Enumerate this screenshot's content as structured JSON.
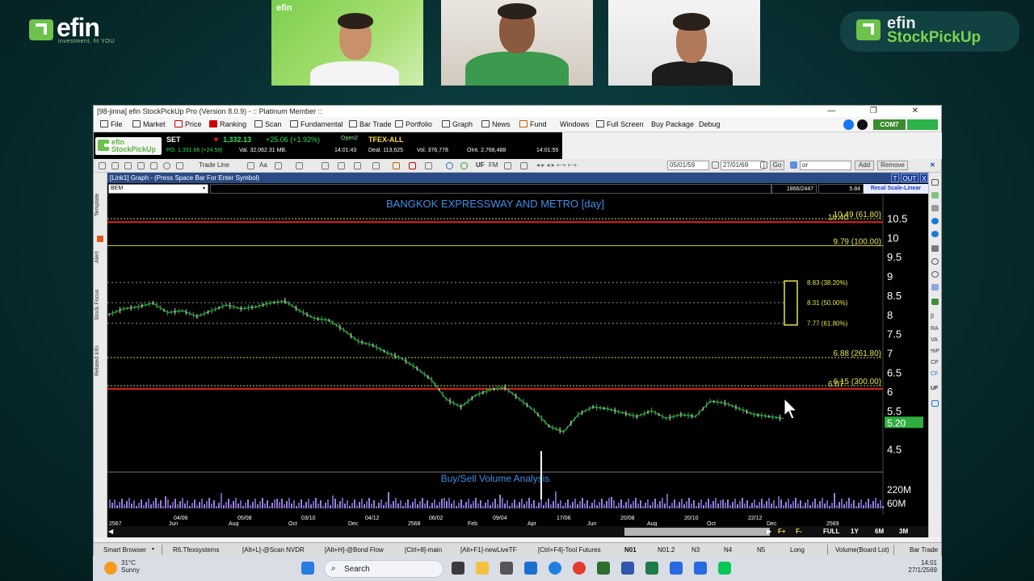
{
  "branding": {
    "left_word": "efin",
    "left_tagline": "investment, fit YOU",
    "right_word1": "efin",
    "right_word2": "StockPickUp",
    "tile_logo": "efin"
  },
  "window": {
    "title": "[98-jinna] efin StockPickUp Pro (Version 8.0.9) - :: Platinum Member ::",
    "controls": "—   ❐   ✕"
  },
  "menu": {
    "items": [
      "File",
      "Market",
      "Price",
      "Ranking",
      "Scan",
      "Fundamental",
      "Bar Trade",
      "Portfolio",
      "Graph",
      "News",
      "Fund",
      "Windows",
      "Full Screen",
      "Buy Package",
      "Debug"
    ],
    "com7": "COM7"
  },
  "ticker": {
    "logo1": "efin",
    "logo2": "StockPickUp",
    "set_label": "SET",
    "set_value": "1,332.13",
    "set_change": "+25.06 (+1.92%)",
    "set_status": "Open2",
    "po_line": "PO. 1,331.66 (+24.59)",
    "val_line": "Val. 32,062.31 MB.",
    "time1": "14:01:43",
    "tfex_label": "TFEX-ALL",
    "deal": "Deal. 113,625",
    "vol": "Vol. 376,778",
    "oint": "OInt. 2,768,488",
    "time2": "14:01:55"
  },
  "toolbar": {
    "trade_line": "Trade Line",
    "aa": "Aa",
    "uf": "UF",
    "fm": "FM",
    "date_from": "05/01/59",
    "date_to": "27/01/69",
    "go": "Go",
    "filter_value": "or",
    "add": "Add",
    "remove": "Remove"
  },
  "graph_header": {
    "title": "[Link1] Graph - (Press Space Bar For Enter Symbol)",
    "btn_t": "T",
    "btn_out": "OUT",
    "btn_x": "X"
  },
  "symbol_bar": {
    "symbol": "BEM",
    "bars_info": "1866/2447",
    "price_info": "5.84",
    "recal": "Recal Scale-Linear"
  },
  "left_tabs": [
    "Template",
    "Alert",
    "Stock Focus",
    "Related Info"
  ],
  "right_tools": [
    "β",
    "RA",
    "VA",
    "%P",
    "CP",
    "CF",
    "UF"
  ],
  "chart_data": {
    "type": "line",
    "title": "BANGKOK EXPRESSWAY AND METRO [day]",
    "subpanel_title": "Buy/Sell Volume Analysis",
    "y_ticks": [
      "10.5",
      "10",
      "9.5",
      "9",
      "8.5",
      "8",
      "7.5",
      "7",
      "6.5",
      "6",
      "5.5",
      "5.20",
      "4.5"
    ],
    "ylim": [
      4.2,
      10.7
    ],
    "volume_ticks": [
      "220M",
      "60M"
    ],
    "current_price": "5.20",
    "fib_levels": [
      {
        "label": "10.49 (61.80)",
        "value": 10.49
      },
      {
        "label": "9.79 (100.00)",
        "value": 9.79
      },
      {
        "label": "6.88 (261.80)",
        "value": 6.88
      },
      {
        "label": "6.15 (300.00)",
        "value": 6.15
      }
    ],
    "red_lines": [
      {
        "label": "10.40",
        "value": 10.4
      },
      {
        "label": "6.07",
        "value": 6.07
      }
    ],
    "box_levels": [
      {
        "label": "8.83 (38.20%)",
        "value": 8.83
      },
      {
        "label": "8.31 (50.00%)",
        "value": 8.31
      },
      {
        "label": "7.77 (61.80%)",
        "value": 7.77
      }
    ],
    "x_ticks_top": [
      "04/06",
      "05/08",
      "03/10",
      "04/12",
      "06/02",
      "09/04",
      "17/06",
      "20/08",
      "20/10",
      "22/12"
    ],
    "x_ticks_bottom": [
      "2567",
      "Jun",
      "Aug",
      "Oct",
      "Dec",
      "2568",
      "Feb",
      "Apr",
      "Jun",
      "Aug",
      "Oct",
      "Dec",
      "2569"
    ],
    "price_series": [
      8.0,
      8.15,
      8.2,
      8.3,
      8.05,
      8.1,
      7.95,
      8.1,
      8.25,
      8.15,
      8.2,
      8.3,
      8.35,
      8.1,
      7.9,
      7.85,
      7.6,
      7.3,
      7.2,
      7.0,
      6.85,
      6.6,
      6.3,
      5.8,
      5.6,
      5.9,
      6.05,
      6.1,
      5.8,
      5.5,
      5.1,
      4.95,
      5.4,
      5.6,
      5.55,
      5.45,
      5.35,
      5.5,
      5.3,
      5.4,
      5.35,
      5.75,
      5.7,
      5.55,
      5.4,
      5.35,
      5.3
    ]
  },
  "periods": [
    "F+",
    "F-",
    "FULL",
    "1Y",
    "6M",
    "3M"
  ],
  "status_tabs": [
    "Smart Browser",
    "R6.Tfexsystems",
    "[Alt+L]-@Scan NVDR",
    "[Alt+H]-@Bond Flow",
    "[Ctrl+8]-main",
    "[Alt+F1]-newLiveTF",
    "[Ctrl+F4]-Tool Futures",
    "N01",
    "N01.2",
    "N3",
    "N4",
    "N5",
    "Long",
    "Volume(Board Lot)",
    "Bar Trade"
  ],
  "taskbar": {
    "temp": "31°C",
    "weather": "Sunny",
    "search": "Search",
    "time": "14:01",
    "date": "27/1/2569"
  }
}
